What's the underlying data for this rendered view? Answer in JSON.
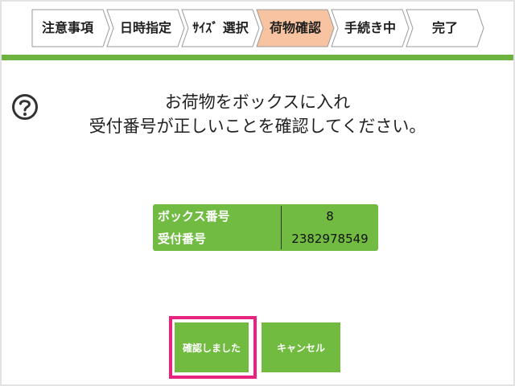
{
  "steps": [
    {
      "label": "注意事項",
      "active": false
    },
    {
      "label": "日時指定",
      "active": false
    },
    {
      "label": "ｻｲｽﾞ 選択",
      "active": false
    },
    {
      "label": "荷物確認",
      "active": true
    },
    {
      "label": "手続き中",
      "active": false
    },
    {
      "label": "完了",
      "active": false
    }
  ],
  "colors": {
    "accent_green": "#6db33f",
    "active_step": "#f7c3a0",
    "highlight": "#e8237d"
  },
  "help_icon": "question-circle-icon",
  "instruction": {
    "line1": "お荷物をボックスに入れ",
    "line2": "受付番号が正しいことを確認してください。"
  },
  "info": {
    "box_label": "ボックス番号",
    "box_value": "8",
    "receipt_label": "受付番号",
    "receipt_value": "2382978549"
  },
  "buttons": {
    "confirm": "確認しました",
    "cancel": "キャンセル"
  }
}
